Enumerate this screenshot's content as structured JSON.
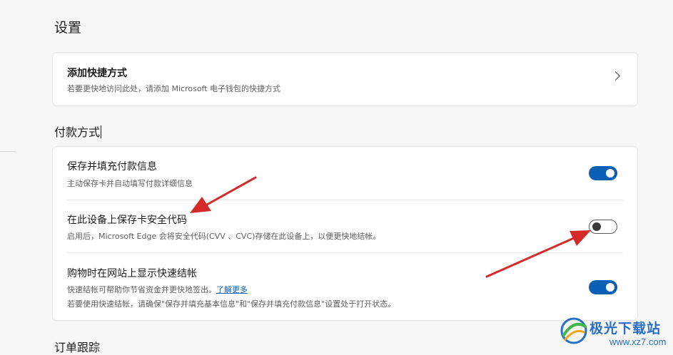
{
  "page": {
    "title": "设置"
  },
  "shortcut": {
    "title": "添加快捷方式",
    "description": "若要更快地访问此处，请添加 Microsoft 电子钱包的快捷方式"
  },
  "payment": {
    "section_title": "付款方式",
    "items": [
      {
        "title": "保存并填充付款信息",
        "description": "主动保存卡并自动填写付款详细信息",
        "enabled": true
      },
      {
        "title": "在此设备上保存卡安全代码",
        "description": "启用后，Microsoft Edge 会将安全代码(CVV 、CVC)存储在此设备上，以便更快地结帐。",
        "enabled": false
      },
      {
        "title": "购物时在网站上显示快速结帐",
        "description": "快速结帐可帮助你节省资金并更快地签出。",
        "link": "了解更多",
        "note": "若要使用快速结帐，请确保\"保存并填充基本信息\"和\"保存并填充付款信息\"设置处于打开状态。",
        "enabled": true
      }
    ]
  },
  "orders": {
    "section_title": "订单跟踪"
  },
  "watermark": {
    "name": "极光下载站",
    "url": "www.xz7.com"
  },
  "colors": {
    "accent": "#0b5fb5",
    "annotation_arrow": "#d42a2a"
  }
}
